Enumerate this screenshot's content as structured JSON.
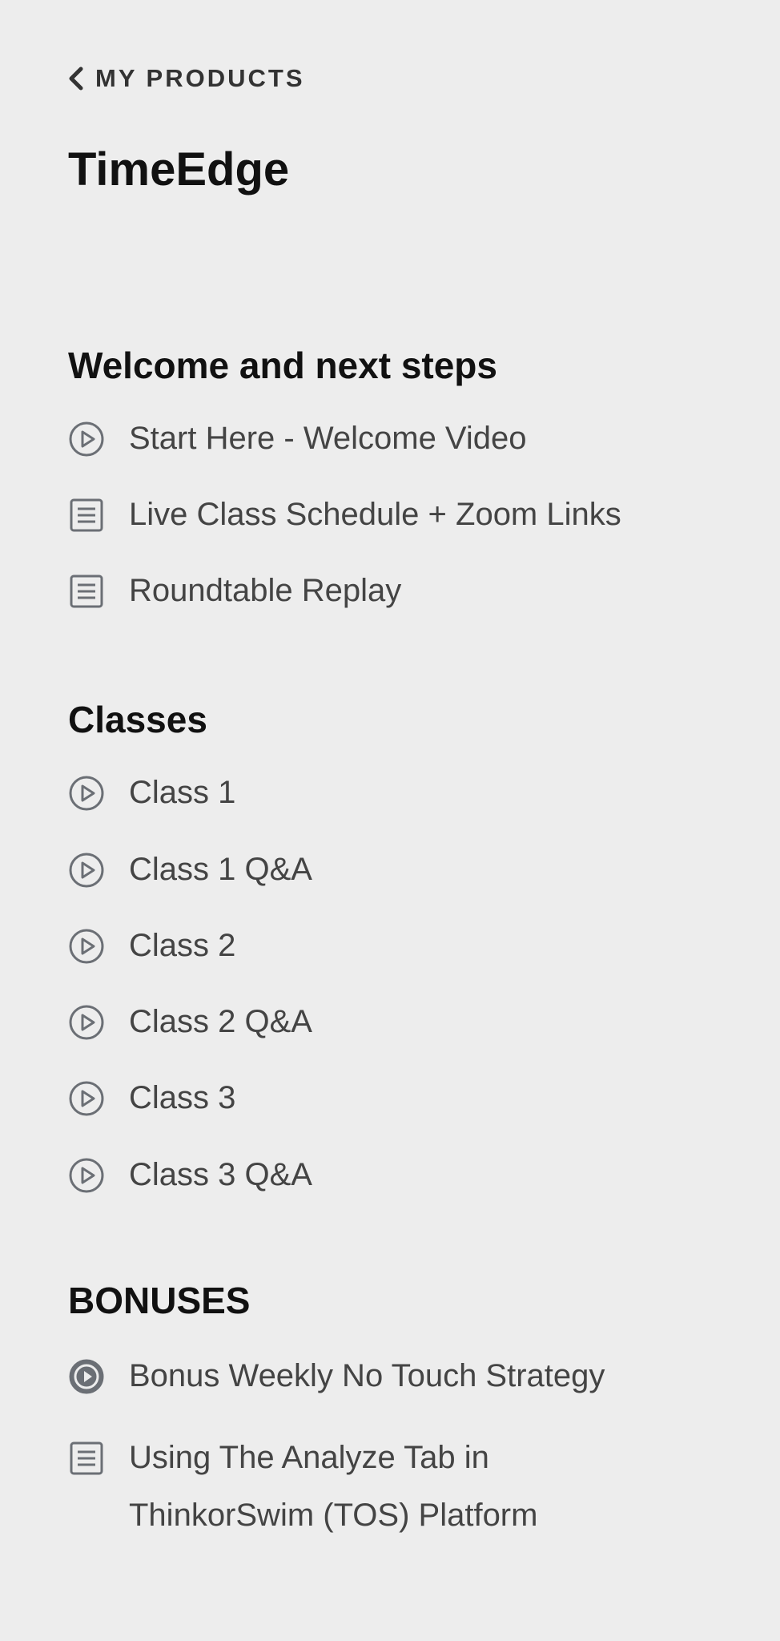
{
  "nav": {
    "back_label": "MY PRODUCTS"
  },
  "product": {
    "title": "TimeEdge"
  },
  "sections": [
    {
      "heading": "Welcome and next steps",
      "lessons": [
        {
          "label": "Start Here - Welcome Video",
          "icon": "play-circle-icon"
        },
        {
          "label": "Live Class Schedule + Zoom Links",
          "icon": "document-icon"
        },
        {
          "label": "Roundtable Replay",
          "icon": "document-icon"
        }
      ]
    },
    {
      "heading": "Classes",
      "lessons": [
        {
          "label": "Class 1",
          "icon": "play-circle-icon"
        },
        {
          "label": "Class 1 Q&A",
          "icon": "play-circle-icon"
        },
        {
          "label": "Class 2",
          "icon": "play-circle-icon"
        },
        {
          "label": "Class 2 Q&A",
          "icon": "play-circle-icon"
        },
        {
          "label": "Class 3",
          "icon": "play-circle-icon"
        },
        {
          "label": "Class 3 Q&A",
          "icon": "play-circle-icon"
        }
      ]
    },
    {
      "heading": "BONUSES",
      "lessons": [
        {
          "label": "Bonus Weekly No Touch Strategy",
          "icon": "in-progress-icon"
        },
        {
          "label": "Using The Analyze Tab in ThinkorSwim (TOS) Platform",
          "icon": "document-icon"
        }
      ]
    }
  ],
  "colors": {
    "background": "#ededed",
    "heading": "#111111",
    "lesson_text": "#444444",
    "icon": "#6b6f75"
  }
}
